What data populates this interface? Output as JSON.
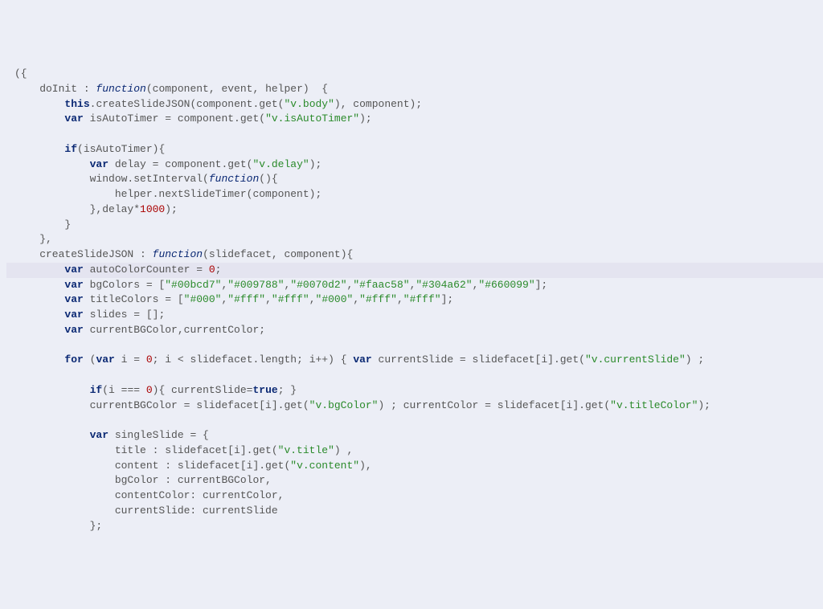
{
  "code": {
    "l1_a": "({",
    "l2_a": "    doInit : ",
    "l2_fn": "function",
    "l2_b": "(component, event, helper)  {",
    "l3_a": "        ",
    "l3_kw": "this",
    "l3_b": ".createSlideJSON(component.get(",
    "l3_s": "\"v.body\"",
    "l3_c": "), component);",
    "l4_a": "        ",
    "l4_kw": "var",
    "l4_b": " isAutoTimer = component.get(",
    "l4_s": "\"v.isAutoTimer\"",
    "l4_c": ");",
    "l5_a": " ",
    "l6_a": "        ",
    "l6_kw": "if",
    "l6_b": "(isAutoTimer){",
    "l7_a": "            ",
    "l7_kw": "var",
    "l7_b": " delay = component.get(",
    "l7_s": "\"v.delay\"",
    "l7_c": ");",
    "l8_a": "            window.setInterval(",
    "l8_fn": "function",
    "l8_b": "(){",
    "l9_a": "                helper.nextSlideTimer(component);",
    "l10_a": "            },delay*",
    "l10_num": "1000",
    "l10_b": ");",
    "l11_a": "        }",
    "l12_a": "    },",
    "l13_a": "    createSlideJSON : ",
    "l13_fn": "function",
    "l13_b": "(slidefacet, component){",
    "l14_a": "        ",
    "l14_kw": "var",
    "l14_b": " autoColorCounter = ",
    "l14_num": "0",
    "l14_c": ";",
    "l15_a": "        ",
    "l15_kw": "var",
    "l15_b": " bgColors = [",
    "l15_s1": "\"#00bcd7\"",
    "l15_c1": ",",
    "l15_s2": "\"#009788\"",
    "l15_c2": ",",
    "l15_s3": "\"#0070d2\"",
    "l15_c3": ",",
    "l15_s4": "\"#faac58\"",
    "l15_c4": ",",
    "l15_s5": "\"#304a62\"",
    "l15_c5": ",",
    "l15_s6": "\"#660099\"",
    "l15_e": "];",
    "l16_a": "        ",
    "l16_kw": "var",
    "l16_b": " titleColors = [",
    "l16_s1": "\"#000\"",
    "l16_c1": ",",
    "l16_s2": "\"#fff\"",
    "l16_c2": ",",
    "l16_s3": "\"#fff\"",
    "l16_c3": ",",
    "l16_s4": "\"#000\"",
    "l16_c4": ",",
    "l16_s5": "\"#fff\"",
    "l16_c5": ",",
    "l16_s6": "\"#fff\"",
    "l16_e": "];",
    "l17_a": "        ",
    "l17_kw": "var",
    "l17_b": " slides = [];",
    "l18_a": "        ",
    "l18_kw": "var",
    "l18_b": " currentBGColor,currentColor;",
    "l19_a": " ",
    "l20_a": "        ",
    "l20_for": "for",
    "l20_b": " (",
    "l20_var": "var",
    "l20_c": " i = ",
    "l20_n1": "0",
    "l20_d": "; i < slidefacet.length; i++) { ",
    "l20_var2": "var",
    "l20_e": " currentSlide = slidefacet[i].get(",
    "l20_s": "\"v.currentSlide\"",
    "l20_f": ") ;",
    "l21_a": " ",
    "l22_a": "            ",
    "l22_if": "if",
    "l22_b": "(i === ",
    "l22_num": "0",
    "l22_c": "){ currentSlide=",
    "l22_true": "true",
    "l22_d": "; }",
    "l23_a": "            currentBGColor = slidefacet[i].get(",
    "l23_s1": "\"v.bgColor\"",
    "l23_b": ") ; currentColor = slidefacet[i].get(",
    "l23_s2": "\"v.titleColor\"",
    "l23_c": ");",
    "l24_a": " ",
    "l25_a": "            ",
    "l25_kw": "var",
    "l25_b": " singleSlide = {",
    "l26_a": "                title : slidefacet[i].get(",
    "l26_s": "\"v.title\"",
    "l26_b": ") ,",
    "l27_a": "                content : slidefacet[i].get(",
    "l27_s": "\"v.content\"",
    "l27_b": "),",
    "l28_a": "                bgColor : currentBGColor,",
    "l29_a": "                contentColor: currentColor,",
    "l30_a": "                currentSlide: currentSlide",
    "l31_a": "            };"
  }
}
